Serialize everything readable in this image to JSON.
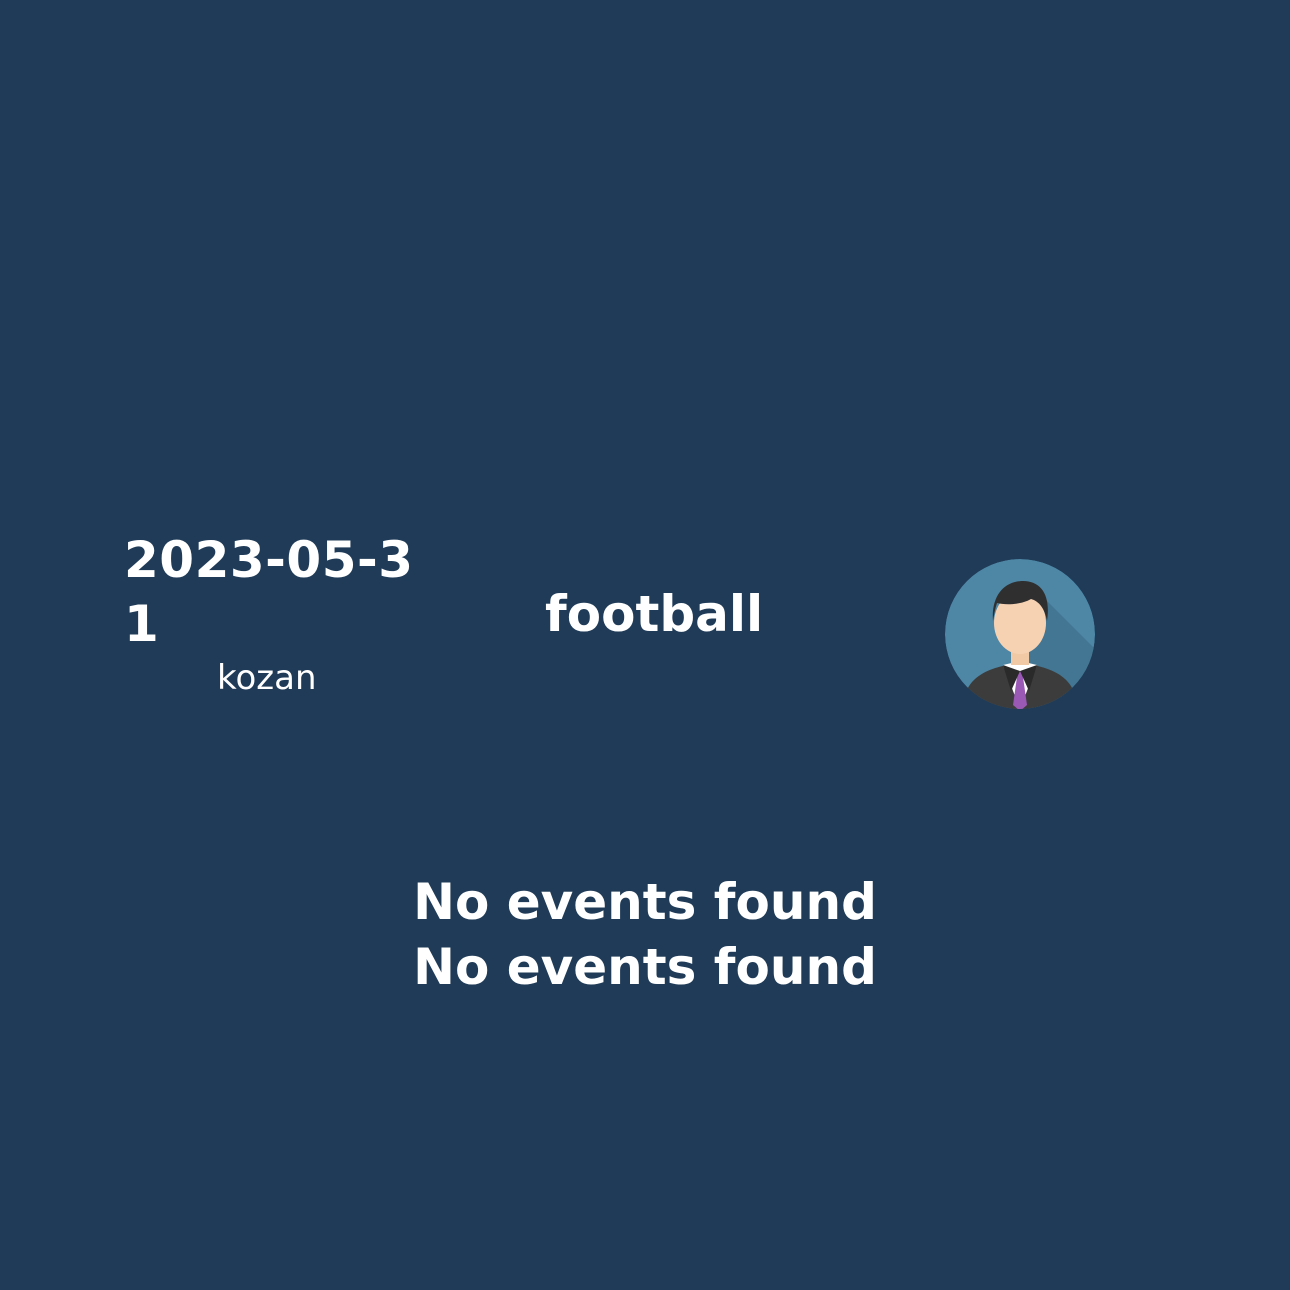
{
  "event": {
    "date": "2023-05-31",
    "username": "kozan",
    "sport": "football",
    "avatar_icon": "businessman-avatar-icon"
  },
  "events_list": {
    "empty_messages": [
      "No events found",
      "No events found"
    ]
  },
  "colors": {
    "background": "#1f3b57",
    "text": "#ffffff",
    "avatar_bg": "#4e86a5",
    "tie": "#9b59b6"
  }
}
